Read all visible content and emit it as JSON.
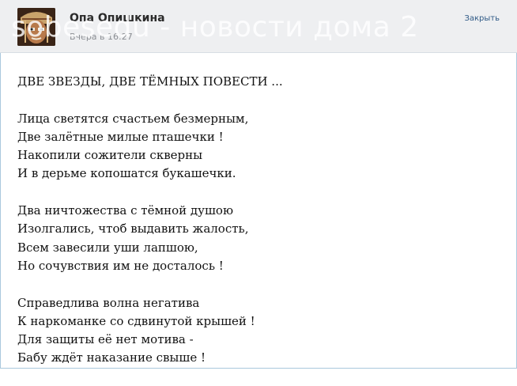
{
  "post": {
    "author": "Опа Опишкина",
    "time": "Вчера в 16:27",
    "close_label": "Закрыть",
    "watermark": "sobesedu - новости дома 2",
    "title": "ДВЕ ЗВЕЗДЫ, ДВЕ ТЁМНЫХ ПОВЕСТИ ...",
    "stanzas": [
      [
        "Лица светятся счастьем безмерным,",
        "Две залётные милые пташечки !",
        "Накопили сожители скверны",
        "И в дерьме копошатся букашечки."
      ],
      [
        "Два ничтожества с тёмной душою",
        "Изолгались, чтоб выдавить жалость,",
        "Всем завесили уши лапшою,",
        "Но сочувствия им не досталось !"
      ],
      [
        "Справедлива волна негатива",
        "К наркоманке со сдвинутой крышей !",
        "Для защиты её нет мотива -",
        "Бабу ждёт наказание свыше !"
      ]
    ]
  }
}
